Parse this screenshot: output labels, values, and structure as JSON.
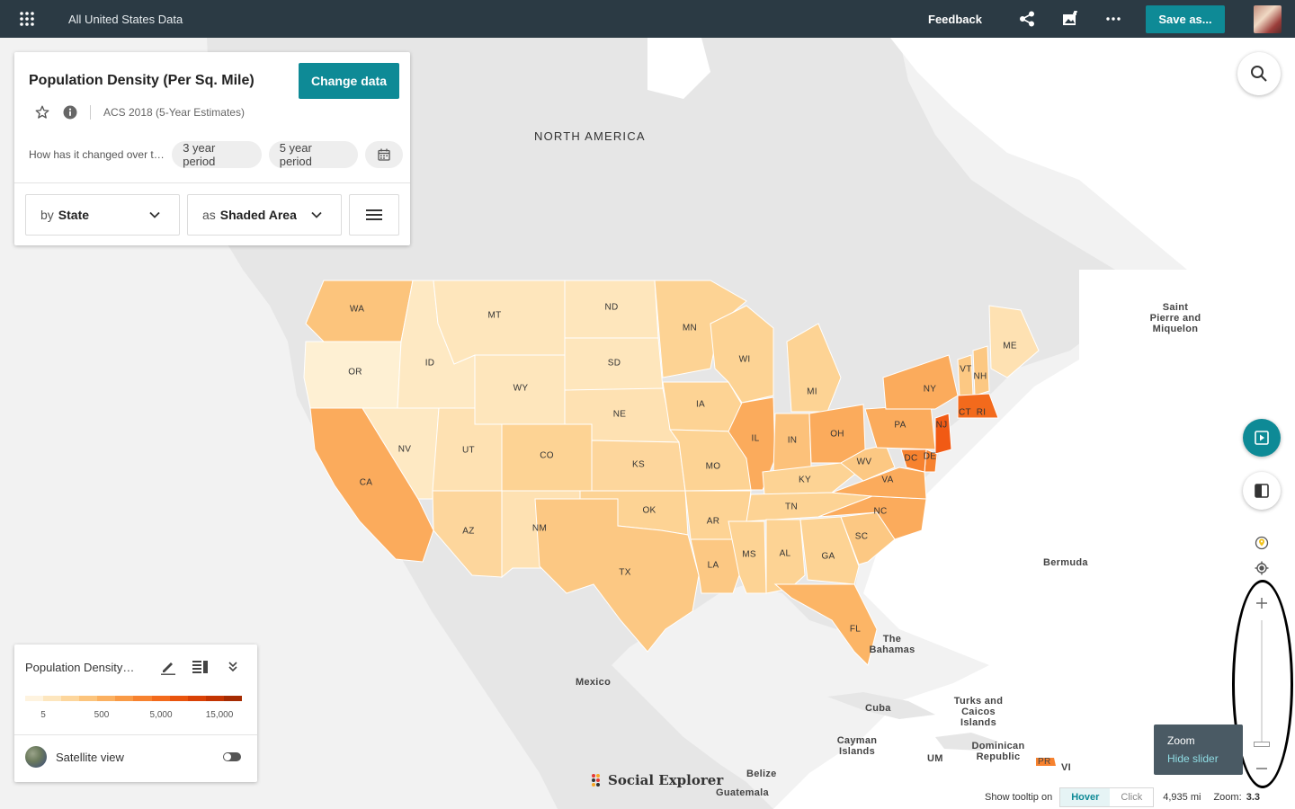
{
  "topbar": {
    "title": "All United States Data",
    "feedback": "Feedback",
    "save_label": "Save as..."
  },
  "data_panel": {
    "title": "Population Density (Per Sq. Mile)",
    "change_data": "Change data",
    "source": "ACS 2018 (5-Year Estimates)",
    "changed_question": "How has it changed over time?",
    "period_3": "3 year period",
    "period_5": "5 year period",
    "geo_prefix": "by",
    "geo_value": "State",
    "viz_prefix": "as",
    "viz_value": "Shaded Area"
  },
  "legend": {
    "title": "Population Density (Per Sq. Mile)",
    "ticks": [
      "5",
      "500",
      "5,000",
      "15,000"
    ],
    "colors": [
      "#fef3df",
      "#fde6be",
      "#fdd69c",
      "#fcc47c",
      "#fbb060",
      "#f99a46",
      "#f7822f",
      "#f36a1c",
      "#e9540d",
      "#d94106",
      "#c33402",
      "#a52b02"
    ],
    "satellite_label": "Satellite view"
  },
  "map": {
    "region_label": "NORTH AMERICA",
    "place_labels": [
      {
        "id": "saint-pierre",
        "text": "Saint\nPierre and\nMiquelon"
      },
      {
        "id": "bermuda",
        "text": "Bermuda"
      },
      {
        "id": "bahamas",
        "text": "The\nBahamas"
      },
      {
        "id": "turks",
        "text": "Turks and\nCaicos\nIslands"
      },
      {
        "id": "cuba",
        "text": "Cuba"
      },
      {
        "id": "cayman",
        "text": "Cayman\nIslands"
      },
      {
        "id": "um",
        "text": "UM"
      },
      {
        "id": "dominican",
        "text": "Dominican\nRepublic"
      },
      {
        "id": "vi",
        "text": "VI"
      },
      {
        "id": "pr",
        "text": "PR"
      },
      {
        "id": "mexico",
        "text": "Mexico"
      },
      {
        "id": "belize",
        "text": "Belize"
      },
      {
        "id": "guatemala",
        "text": "Guatemala"
      }
    ],
    "states": [
      {
        "abbr": "WA"
      },
      {
        "abbr": "OR"
      },
      {
        "abbr": "CA"
      },
      {
        "abbr": "ID"
      },
      {
        "abbr": "NV"
      },
      {
        "abbr": "MT"
      },
      {
        "abbr": "WY"
      },
      {
        "abbr": "UT"
      },
      {
        "abbr": "AZ"
      },
      {
        "abbr": "CO"
      },
      {
        "abbr": "NM"
      },
      {
        "abbr": "ND"
      },
      {
        "abbr": "SD"
      },
      {
        "abbr": "NE"
      },
      {
        "abbr": "KS"
      },
      {
        "abbr": "OK"
      },
      {
        "abbr": "TX"
      },
      {
        "abbr": "MN"
      },
      {
        "abbr": "IA"
      },
      {
        "abbr": "MO"
      },
      {
        "abbr": "AR"
      },
      {
        "abbr": "LA"
      },
      {
        "abbr": "WI"
      },
      {
        "abbr": "IL"
      },
      {
        "abbr": "MI"
      },
      {
        "abbr": "IN"
      },
      {
        "abbr": "OH"
      },
      {
        "abbr": "KY"
      },
      {
        "abbr": "TN"
      },
      {
        "abbr": "MS"
      },
      {
        "abbr": "AL"
      },
      {
        "abbr": "GA"
      },
      {
        "abbr": "FL"
      },
      {
        "abbr": "SC"
      },
      {
        "abbr": "NC"
      },
      {
        "abbr": "VA"
      },
      {
        "abbr": "WV"
      },
      {
        "abbr": "PA"
      },
      {
        "abbr": "NY"
      },
      {
        "abbr": "VT"
      },
      {
        "abbr": "NH"
      },
      {
        "abbr": "ME"
      },
      {
        "abbr": "CT"
      },
      {
        "abbr": "RI"
      },
      {
        "abbr": "NJ"
      },
      {
        "abbr": "DE"
      },
      {
        "abbr": "DC"
      }
    ]
  },
  "zoom": {
    "tooltip_title": "Zoom",
    "tooltip_action": "Hide slider"
  },
  "bottombar": {
    "tooltip_label": "Show tooltip on",
    "hover": "Hover",
    "click": "Click",
    "scale": "4,935 mi",
    "zoom_label": "Zoom:",
    "zoom_value": "3.3"
  },
  "brand": "Social Explorer",
  "colors": {
    "topbar": "#2b3a44",
    "accent": "#0e8a96",
    "land_background": "#e9e9e9",
    "water": "#ffffff"
  }
}
